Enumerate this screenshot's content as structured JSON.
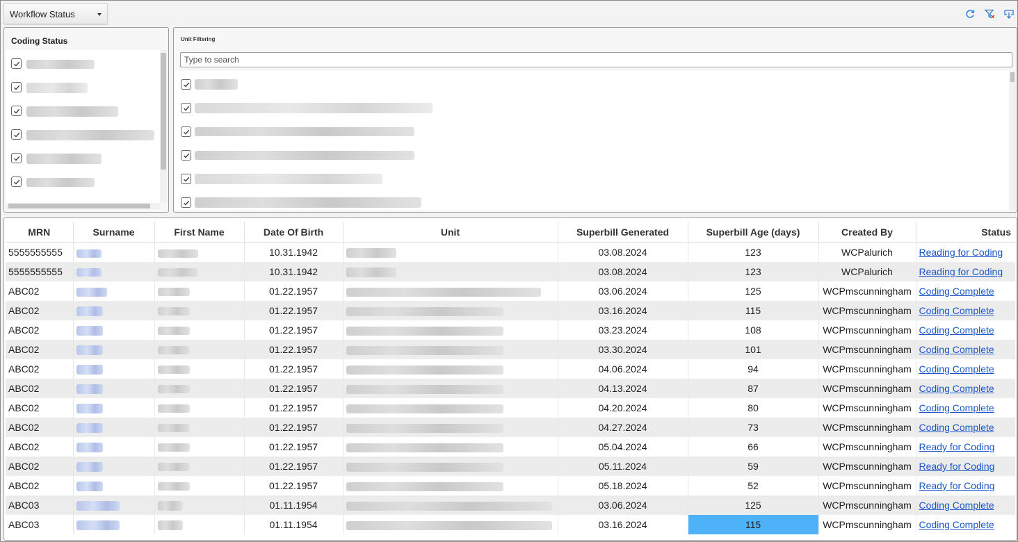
{
  "toolbar": {
    "dropdown_label": "Workflow Status",
    "icons": [
      "refresh-icon",
      "clear-filter-icon",
      "export-icon"
    ],
    "accent_color": "#2f7bd6"
  },
  "coding_status": {
    "title": "Coding Status",
    "items": [
      {
        "checked": true
      },
      {
        "checked": true
      },
      {
        "checked": true
      },
      {
        "checked": true
      },
      {
        "checked": true
      },
      {
        "checked": true
      }
    ]
  },
  "unit_filtering": {
    "title": "Unit Filtering",
    "search_placeholder": "Type to search",
    "items": [
      {
        "checked": true
      },
      {
        "checked": true
      },
      {
        "checked": true
      },
      {
        "checked": true
      },
      {
        "checked": true
      },
      {
        "checked": true
      }
    ]
  },
  "table": {
    "columns": [
      "MRN",
      "Surname",
      "First Name",
      "Date Of Birth",
      "Unit",
      "Superbill Generated",
      "Superbill Age (days)",
      "Created By",
      "Status"
    ],
    "rows": [
      {
        "mrn": "5555555555",
        "dob": "10.31.1942",
        "generated": "03.08.2024",
        "age": "123",
        "created_by": "WCPalurich",
        "status": "Reading for Coding"
      },
      {
        "mrn": "5555555555",
        "dob": "10.31.1942",
        "generated": "03.08.2024",
        "age": "123",
        "created_by": "WCPalurich",
        "status": "Reading for Coding"
      },
      {
        "mrn": "ABC02",
        "dob": "01.22.1957",
        "generated": "03.06.2024",
        "age": "125",
        "created_by": "WCPmscunningham",
        "status": "Coding Complete"
      },
      {
        "mrn": "ABC02",
        "dob": "01.22.1957",
        "generated": "03.16.2024",
        "age": "115",
        "created_by": "WCPmscunningham",
        "status": "Coding Complete"
      },
      {
        "mrn": "ABC02",
        "dob": "01.22.1957",
        "generated": "03.23.2024",
        "age": "108",
        "created_by": "WCPmscunningham",
        "status": "Coding Complete"
      },
      {
        "mrn": "ABC02",
        "dob": "01.22.1957",
        "generated": "03.30.2024",
        "age": "101",
        "created_by": "WCPmscunningham",
        "status": "Coding Complete"
      },
      {
        "mrn": "ABC02",
        "dob": "01.22.1957",
        "generated": "04.06.2024",
        "age": "94",
        "created_by": "WCPmscunningham",
        "status": "Coding Complete"
      },
      {
        "mrn": "ABC02",
        "dob": "01.22.1957",
        "generated": "04.13.2024",
        "age": "87",
        "created_by": "WCPmscunningham",
        "status": "Coding Complete"
      },
      {
        "mrn": "ABC02",
        "dob": "01.22.1957",
        "generated": "04.20.2024",
        "age": "80",
        "created_by": "WCPmscunningham",
        "status": "Coding Complete"
      },
      {
        "mrn": "ABC02",
        "dob": "01.22.1957",
        "generated": "04.27.2024",
        "age": "73",
        "created_by": "WCPmscunningham",
        "status": "Coding Complete"
      },
      {
        "mrn": "ABC02",
        "dob": "01.22.1957",
        "generated": "05.04.2024",
        "age": "66",
        "created_by": "WCPmscunningham",
        "status": "Ready for Coding"
      },
      {
        "mrn": "ABC02",
        "dob": "01.22.1957",
        "generated": "05.11.2024",
        "age": "59",
        "created_by": "WCPmscunningham",
        "status": "Ready for Coding"
      },
      {
        "mrn": "ABC02",
        "dob": "01.22.1957",
        "generated": "05.18.2024",
        "age": "52",
        "created_by": "WCPmscunningham",
        "status": "Ready for Coding"
      },
      {
        "mrn": "ABC03",
        "dob": "01.11.1954",
        "generated": "03.06.2024",
        "age": "125",
        "created_by": "WCPmscunningham",
        "status": "Coding Complete"
      },
      {
        "mrn": "ABC03",
        "dob": "01.11.1954",
        "generated": "03.16.2024",
        "age": "115",
        "created_by": "WCPmscunningham",
        "status": "Coding Complete",
        "age_selected": true
      }
    ],
    "selected_color": "#4db2f7",
    "link_color": "#1a56c9"
  }
}
